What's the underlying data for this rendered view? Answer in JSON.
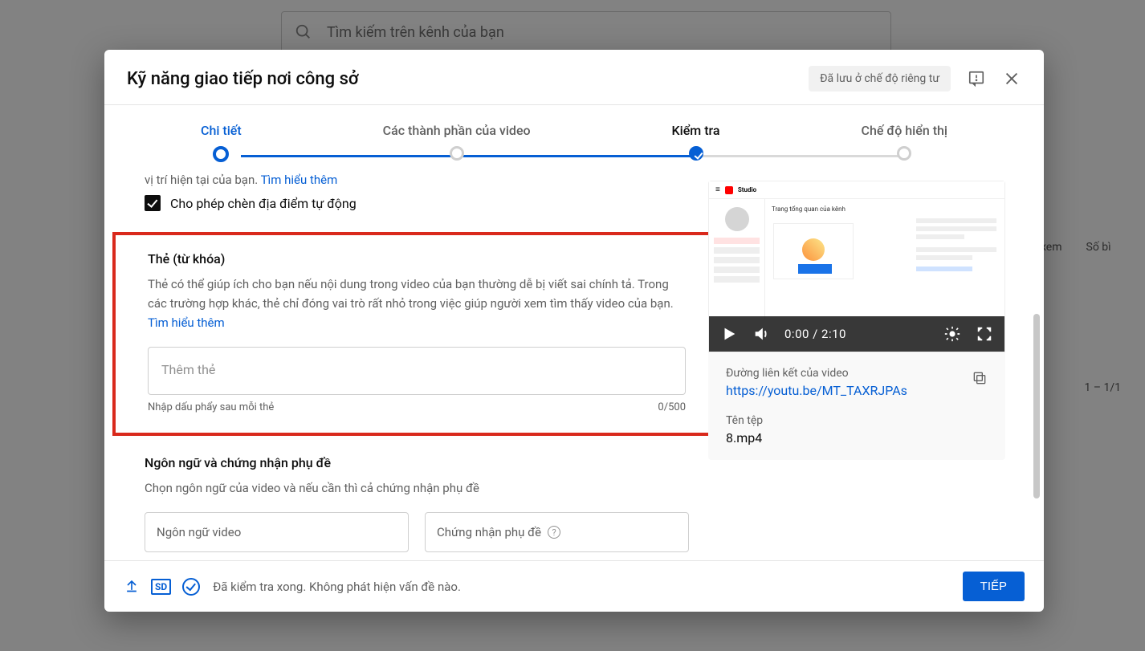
{
  "bg": {
    "search_placeholder": "Tìm kiếm trên kênh của bạn",
    "col_xem": "xem",
    "col_sobi": "Số bì",
    "paging": "1 – 1/1"
  },
  "modal": {
    "title": "Kỹ năng giao tiếp nơi công sở",
    "status_pill": "Đã lưu ở chế độ riêng tư"
  },
  "stepper": {
    "s1": "Chi tiết",
    "s2": "Các thành phần của video",
    "s3": "Kiểm tra",
    "s4": "Chế độ hiển thị"
  },
  "body": {
    "loc_line_tail": "vị trí hiện tại của bạn. ",
    "loc_learn": "Tìm hiểu thêm",
    "loc_checkbox": "Cho phép chèn địa điểm tự động",
    "tags_title": "Thẻ (từ khóa)",
    "tags_desc": "Thẻ có thể giúp ích cho bạn nếu nội dung trong video của bạn thường dễ bị viết sai chính tả. Trong các trường hợp khác, thẻ chỉ đóng vai trò rất nhỏ trong việc giúp người xem tìm thấy video của bạn. ",
    "tags_learn": "Tìm hiểu thêm",
    "tags_placeholder": "Thêm thẻ",
    "tags_hint": "Nhập dấu phẩy sau mỗi thẻ",
    "tags_count": "0/500",
    "lang_title": "Ngôn ngữ và chứng nhận phụ đề",
    "lang_desc": "Chọn ngôn ngữ của video và nếu cần thì cả chứng nhận phụ đề",
    "lang_select": "Ngôn ngữ video",
    "caption_select": "Chứng nhận phụ đề"
  },
  "preview": {
    "sim_brand": "Studio",
    "sim_heading": "Trang tổng quan của kênh",
    "time": "0:00 / 2:10",
    "link_label": "Đường liên kết của video",
    "link_value": "https://youtu.be/MT_TAXRJPAs",
    "file_label": "Tên tệp",
    "file_value": "8.mp4"
  },
  "footer": {
    "sd": "SD",
    "msg": "Đã kiểm tra xong. Không phát hiện vấn đề nào.",
    "next": "TIẾP"
  }
}
